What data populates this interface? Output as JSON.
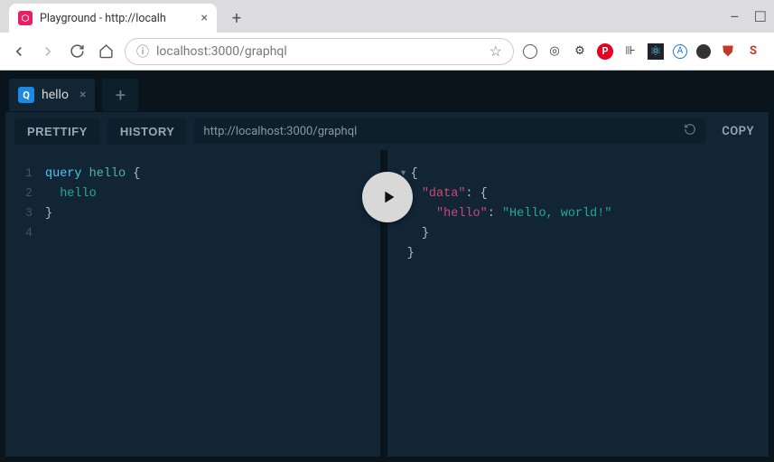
{
  "browser": {
    "tab_title": "Playground - http://localh",
    "url": {
      "host_dim": "localhost",
      "port": ":3000",
      "path": "/graphql"
    },
    "extension_icons": [
      "circle",
      "person",
      "gear",
      "pinterest",
      "columns",
      "react",
      "a-circle",
      "moon",
      "shield",
      "s"
    ]
  },
  "playground": {
    "tabs": [
      {
        "icon": "Q",
        "name": "hello"
      }
    ],
    "toolbar": {
      "prettify": "PRETTIFY",
      "history": "HISTORY",
      "endpoint": "http://localhost:3000/graphql",
      "copy": "COPY"
    },
    "editor": {
      "line_count": 4,
      "tokens": {
        "kw_query": "query",
        "op_name": "hello",
        "brace_open": "{",
        "field": "hello",
        "brace_close": "}"
      }
    },
    "result": {
      "root_open": "{",
      "data_key": "\"data\"",
      "hello_key": "\"hello\"",
      "hello_val": "\"Hello, world!\"",
      "colon": ":",
      "brace_open": "{",
      "brace_close": "}"
    }
  }
}
